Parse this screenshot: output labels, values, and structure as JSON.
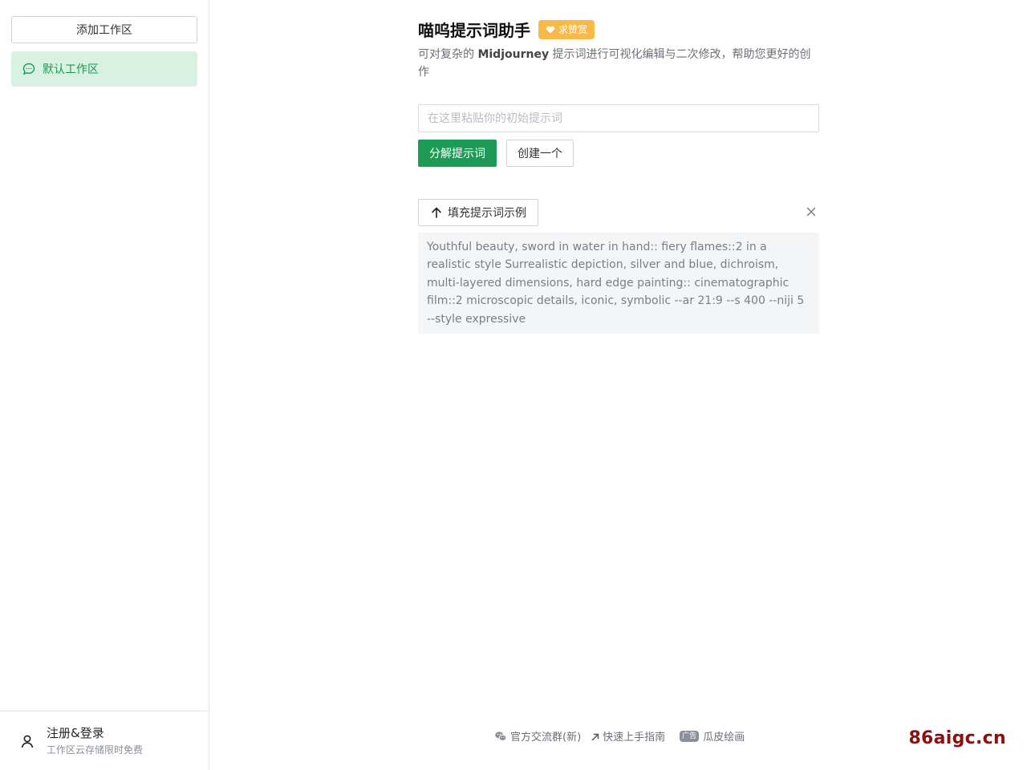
{
  "sidebar": {
    "add_workspace_label": "添加工作区",
    "workspaces": [
      {
        "label": "默认工作区",
        "icon": "chat-bubble-icon",
        "active": true
      }
    ],
    "footer": {
      "title": "注册&登录",
      "subtitle": "工作区云存储限时免费",
      "icon": "user-icon"
    }
  },
  "header": {
    "title": "喵呜提示词助手",
    "badge_label": "求赞赏",
    "badge_icon": "heart-icon",
    "desc_pre": "可对复杂的 ",
    "desc_bold": "Midjourney",
    "desc_post": " 提示词进行可视化编辑与二次修改，帮助您更好的创作"
  },
  "input": {
    "value": "",
    "placeholder": "在这里粘贴你的初始提示词"
  },
  "actions": {
    "parse_label": "分解提示词",
    "create_label": "创建一个"
  },
  "example": {
    "fill_label": "填充提示词示例",
    "fill_icon": "arrow-up-icon",
    "close_icon": "close-icon",
    "text": "Youthful beauty, sword in water in hand:: fiery flames::2 in a realistic style Surrealistic depiction, silver and blue, dichroism, multi-layered dimensions, hard edge painting:: cinematographic film::2 microscopic details, iconic, symbolic --ar 21:9 --s 400 --niji 5 --style expressive"
  },
  "footer": {
    "links": [
      {
        "label": "官方交流群(新)",
        "icon": "wechat-icon"
      },
      {
        "label": "快速上手指南",
        "icon": "external-arrow-icon"
      },
      {
        "label": "瓜皮绘画",
        "tag": "广告"
      }
    ],
    "watermark": "86aigc.cn"
  },
  "colors": {
    "primary": "#1d9a55",
    "active_bg": "#d9f1e2",
    "badge": "#f6b94a",
    "watermark": "#8a0f0f"
  }
}
